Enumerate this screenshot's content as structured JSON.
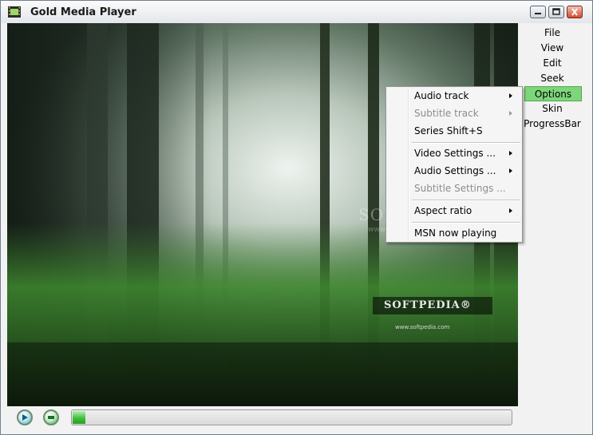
{
  "window": {
    "title": "Gold Media Player"
  },
  "video": {
    "watermark": "SOFTPEDIA",
    "watermark_url": "www.softpedia.com",
    "logo": "SOFTPEDIA®",
    "logo_url": "www.softpedia.com"
  },
  "side_menu": {
    "items": [
      {
        "label": "File"
      },
      {
        "label": "View"
      },
      {
        "label": "Edit"
      },
      {
        "label": "Seek"
      },
      {
        "label": "Options",
        "active": true
      },
      {
        "label": "Skin"
      },
      {
        "label": "ProgressBar"
      }
    ]
  },
  "context_menu": {
    "items": [
      {
        "label": "Audio track",
        "submenu": true,
        "enabled": true
      },
      {
        "label": "Subtitle track",
        "submenu": true,
        "enabled": false
      },
      {
        "label": "Series Shift+S",
        "submenu": false,
        "enabled": true
      },
      {
        "label": "Video Settings ...",
        "submenu": true,
        "enabled": true
      },
      {
        "label": "Audio Settings ...",
        "submenu": true,
        "enabled": true
      },
      {
        "label": "Subtitle Settings ...",
        "submenu": false,
        "enabled": false
      },
      {
        "label": "Aspect ratio",
        "submenu": true,
        "enabled": true
      },
      {
        "label": "MSN now playing",
        "submenu": false,
        "enabled": true
      }
    ]
  },
  "controls": {
    "progress_fraction": 0.03
  },
  "colors": {
    "accent_green": "#7ed67b",
    "progress_green": "#3ec13a"
  }
}
